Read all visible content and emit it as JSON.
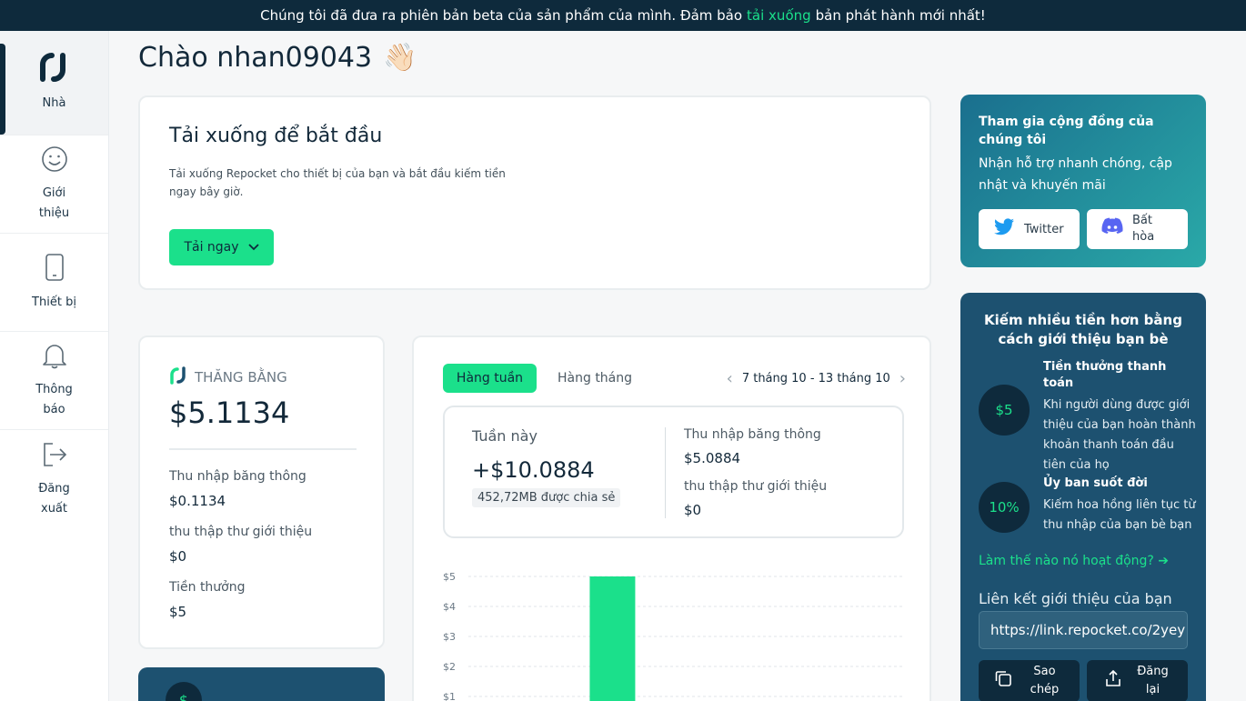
{
  "banner": {
    "text_before": "Chúng tôi đã đưa ra phiên bản beta của sản phẩm của mình. Đảm bảo",
    "link": "tải xuống",
    "text_after": "bản phát hành mới nhất!"
  },
  "sidebar": {
    "items": [
      {
        "label": "Nhà",
        "icon": "logo-icon"
      },
      {
        "label": "Giới thiệu",
        "icon": "smile-icon"
      },
      {
        "label": "Thiết bị",
        "icon": "phone-icon"
      },
      {
        "label": "Thông báo",
        "icon": "bell-icon"
      },
      {
        "label": "Đăng xuất",
        "icon": "logout-icon"
      }
    ]
  },
  "greeting": {
    "text": "Chào nhan09043",
    "emoji": "👋🏻"
  },
  "download": {
    "title": "Tải xuống để bắt đầu",
    "description": "Tải xuống Repocket cho thiết bị của bạn và bắt đầu kiếm tiền ngay bây giờ.",
    "button": "Tải ngay"
  },
  "balance": {
    "heading": "THĂNG BẰNG",
    "amount": "$5.1134",
    "rows": [
      {
        "label": "Thu nhập băng thông",
        "value": "$0.1134"
      },
      {
        "label": "thu thập thư giới thiệu",
        "value": "$0"
      },
      {
        "label": "Tiền thưởng",
        "value": "$5"
      }
    ]
  },
  "earnings": {
    "tab_weekly": "Hàng tuần",
    "tab_monthly": "Hàng tháng",
    "date_range": "7 tháng 10 - 13 tháng 10",
    "this_week_label": "Tuần này",
    "this_week_amount": "+$10.0884",
    "shared": "452,72MB được chia sẻ",
    "bandwidth_label": "Thu nhập băng thông",
    "bandwidth_value": "$5.0884",
    "referral_label": "thu thập thư giới thiệu",
    "referral_value": "$0"
  },
  "chart_data": {
    "type": "bar",
    "y_tick_labels": [
      "$5",
      "$4",
      "$3",
      "$2",
      "$1"
    ],
    "ylim": [
      0,
      5
    ],
    "values": [
      0,
      5,
      0,
      0,
      0,
      0,
      0
    ],
    "color": "#1be08b"
  },
  "community": {
    "title": "Tham gia cộng đồng của chúng tôi",
    "subtitle": "Nhận hỗ trợ nhanh chóng, cập nhật và khuyến mãi",
    "twitter": "Twitter",
    "discord": "Bất hòa"
  },
  "referral": {
    "title": "Kiếm nhiều tiền hơn bằng cách giới thiệu bạn bè",
    "bonus_circle": "$5",
    "bonus_title": "Tiền thưởng thanh toán",
    "bonus_desc": "Khi người dùng được giới thiệu của bạn hoàn thành khoản thanh toán đầu tiên của họ",
    "lifetime_circle": "10%",
    "lifetime_title": "Ủy ban suốt đời",
    "lifetime_desc": "Kiếm hoa hồng liên tục từ thu nhập của bạn bè bạn",
    "how_link": "Làm thế nào nó hoạt động? ➔",
    "link_label": "Liên kết giới thiệu của bạn",
    "link_value": "https://link.repocket.co/2yey",
    "copy_btn": "Sao chép",
    "share_btn": "Đăng lại"
  },
  "colors": {
    "accent": "#1be08b",
    "dark": "#0e2a3c",
    "panel": "#1d5170"
  }
}
